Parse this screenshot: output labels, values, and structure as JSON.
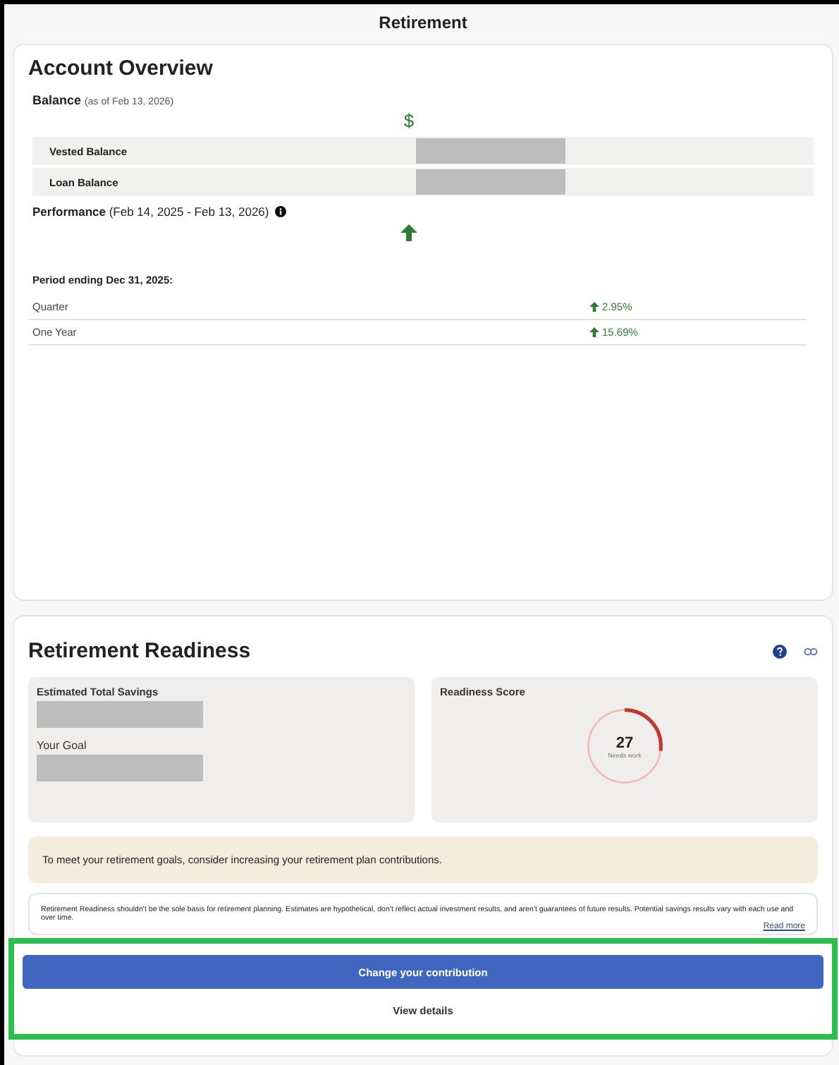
{
  "window": {
    "title": "Retirement"
  },
  "account_overview": {
    "title": "Account Overview",
    "balance": {
      "label": "Balance",
      "as_of": "(as of Feb 13, 2026)",
      "currency_symbol": "$",
      "rows": [
        {
          "label": "Vested Balance"
        },
        {
          "label": "Loan Balance"
        }
      ]
    },
    "performance": {
      "label": "Performance",
      "range": "(Feb 14, 2025 - Feb 13, 2026)",
      "period_label": "Period ending Dec 31, 2025:",
      "rows": [
        {
          "label": "Quarter",
          "value": "2.95%"
        },
        {
          "label": "One Year",
          "value": "15.69%"
        }
      ]
    }
  },
  "retirement_readiness": {
    "title": "Retirement Readiness",
    "estimated_total_savings": {
      "label": "Estimated Total Savings"
    },
    "your_goal": {
      "label": "Your Goal"
    },
    "score": {
      "label": "Readiness Score",
      "value": "27",
      "status": "Needs work",
      "level": 0.27
    },
    "notice": "To meet your retirement goals, consider increasing your retirement plan contributions.",
    "disclaimer": "Retirement Readiness shouldn't be the sole basis for retirement planning. Estimates are hypothetical, don't reflect actual investment results, and aren't guarantees of future results. Potential savings results vary with each use and over time.",
    "read_more": "Read more"
  },
  "buttons": [
    {
      "label": "Change your contribution",
      "kind": "primary"
    },
    {
      "label": "View details",
      "kind": "secondary"
    }
  ]
}
